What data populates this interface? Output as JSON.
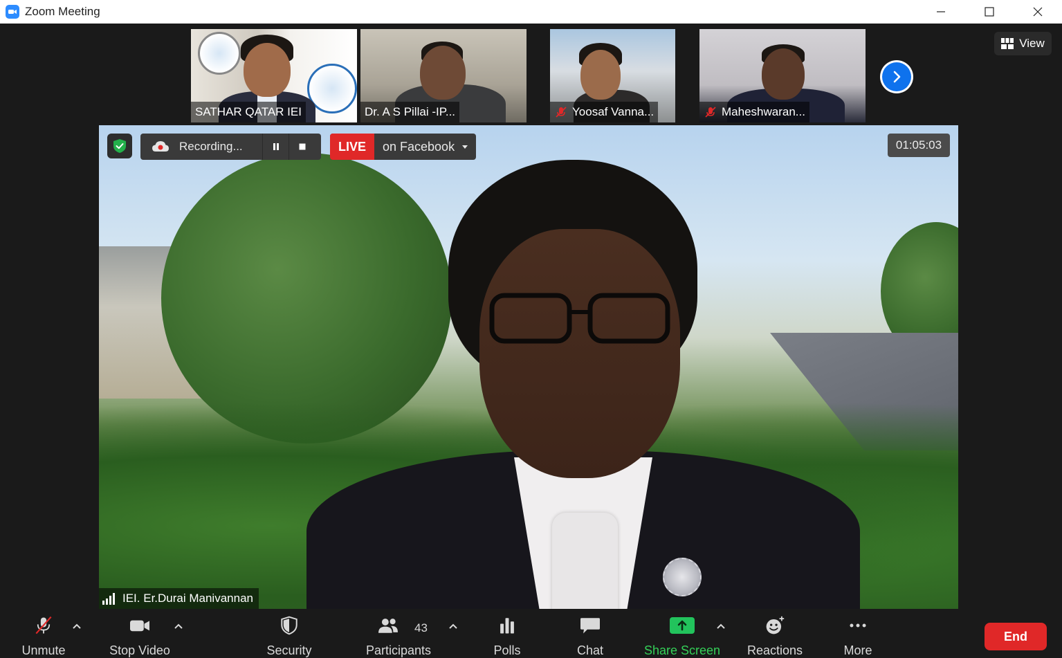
{
  "window": {
    "title": "Zoom Meeting"
  },
  "participants_strip": [
    {
      "name": "SATHAR QATAR IEI",
      "muted": false
    },
    {
      "name": "Dr. A S Pillai -IP...",
      "muted": false
    },
    {
      "name": "Yoosaf Vanna...",
      "muted": true
    },
    {
      "name": "Maheshwaran...",
      "muted": true
    }
  ],
  "view_button": {
    "label": "View"
  },
  "recording": {
    "label": "Recording..."
  },
  "live": {
    "tag": "LIVE",
    "label": "on Facebook"
  },
  "timer": {
    "value": "01:05:03"
  },
  "main_speaker": {
    "name": "IEI. Er.Durai Manivannan"
  },
  "toolbar": {
    "unmute": "Unmute",
    "stop_video": "Stop Video",
    "security": "Security",
    "participants": "Participants",
    "participants_count": "43",
    "polls": "Polls",
    "chat": "Chat",
    "share_screen": "Share Screen",
    "reactions": "Reactions",
    "more": "More",
    "end": "End"
  },
  "colors": {
    "accent_blue": "#0e72ed",
    "live_red": "#e02828",
    "share_green": "#22c35c",
    "background": "#1a1a1a"
  }
}
